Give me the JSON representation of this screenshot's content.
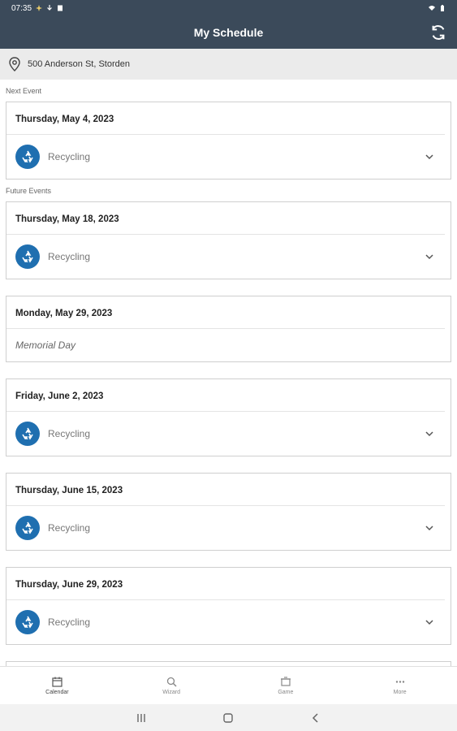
{
  "status_bar": {
    "time": "07:35"
  },
  "app_bar": {
    "title": "My Schedule"
  },
  "address": {
    "text": "500 Anderson St, Storden"
  },
  "sections": {
    "next_label": "Next Event",
    "future_label": "Future Events"
  },
  "next_event": {
    "date": "Thursday, May 4, 2023",
    "item": "Recycling"
  },
  "future_events": [
    {
      "date": "Thursday, May 18, 2023",
      "item": "Recycling"
    },
    {
      "date": "Monday, May 29, 2023",
      "holiday": "Memorial Day"
    },
    {
      "date": "Friday, June 2, 2023",
      "item": "Recycling"
    },
    {
      "date": "Thursday, June 15, 2023",
      "item": "Recycling"
    },
    {
      "date": "Thursday, June 29, 2023",
      "item": "Recycling"
    }
  ],
  "bottom_nav": [
    {
      "label": "Calendar",
      "icon": "calendar-icon",
      "active": true
    },
    {
      "label": "Wizard",
      "icon": "search-icon"
    },
    {
      "label": "Game",
      "icon": "game-icon"
    },
    {
      "label": "More",
      "icon": "more-icon"
    }
  ],
  "colors": {
    "header": "#3b4a5a",
    "recycle": "#1f6fb0"
  }
}
